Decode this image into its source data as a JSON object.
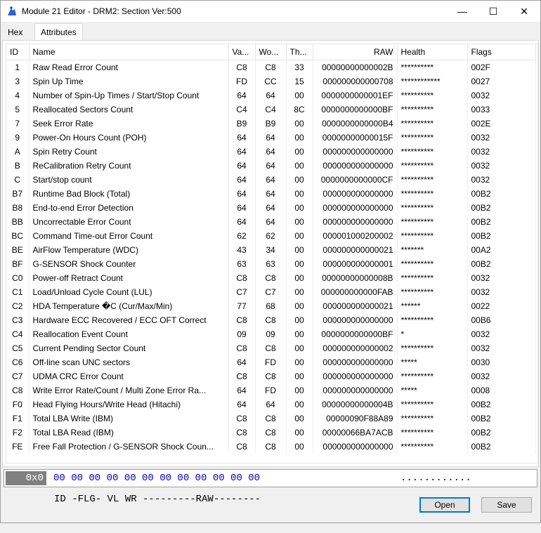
{
  "window": {
    "title": "Module 21 Editor - DRM2: Section Ver:500",
    "min_glyph": "—",
    "max_glyph": "☐",
    "close_glyph": "✕"
  },
  "tabs": [
    "Hex",
    "Attributes"
  ],
  "active_tab": "Attributes",
  "table": {
    "headers": [
      "ID",
      "Name",
      "Va...",
      "Wo...",
      "Th...",
      "RAW",
      "Health",
      "Flags"
    ],
    "rows": [
      [
        "1",
        "Raw Read Error Count",
        "C8",
        "C8",
        "33",
        "00000000000002B",
        "**********",
        "002F"
      ],
      [
        "3",
        "Spin Up Time",
        "FD",
        "CC",
        "15",
        "000000000000708",
        "************",
        "0027"
      ],
      [
        "4",
        "Number of Spin-Up Times / Start/Stop Count",
        "64",
        "64",
        "00",
        "0000000000001EF",
        "**********",
        "0032"
      ],
      [
        "5",
        "Reallocated Sectors Count",
        "C4",
        "C4",
        "8C",
        "0000000000000BF",
        "**********",
        "0033"
      ],
      [
        "7",
        "Seek Error Rate",
        "B9",
        "B9",
        "00",
        "0000000000000B4",
        "**********",
        "002E"
      ],
      [
        "9",
        "Power-On Hours Count (POH)",
        "64",
        "64",
        "00",
        "00000000000015F",
        "**********",
        "0032"
      ],
      [
        "A",
        "Spin Retry Count",
        "64",
        "64",
        "00",
        "000000000000000",
        "**********",
        "0032"
      ],
      [
        "B",
        "ReCalibration Retry Count",
        "64",
        "64",
        "00",
        "000000000000000",
        "**********",
        "0032"
      ],
      [
        "C",
        "Start/stop count",
        "64",
        "64",
        "00",
        "0000000000000CF",
        "**********",
        "0032"
      ],
      [
        "B7",
        "Runtime Bad Block (Total)",
        "64",
        "64",
        "00",
        "000000000000000",
        "**********",
        "00B2"
      ],
      [
        "B8",
        "End-to-end Error Detection",
        "64",
        "64",
        "00",
        "000000000000000",
        "**********",
        "00B2"
      ],
      [
        "BB",
        "Uncorrectable Error Count",
        "64",
        "64",
        "00",
        "000000000000000",
        "**********",
        "00B2"
      ],
      [
        "BC",
        "Command Time-out Error Count",
        "62",
        "62",
        "00",
        "000001000200002",
        "**********",
        "00B2"
      ],
      [
        "BE",
        "AirFlow Temperature (WDC)",
        "43",
        "34",
        "00",
        "000000000000021",
        "*******",
        "00A2"
      ],
      [
        "BF",
        "G-SENSOR Shock Counter",
        "63",
        "63",
        "00",
        "000000000000001",
        "**********",
        "00B2"
      ],
      [
        "C0",
        "Power-off Retract Count",
        "C8",
        "C8",
        "00",
        "00000000000008B",
        "**********",
        "0032"
      ],
      [
        "C1",
        "Load/Unload Cycle Count (LUL)",
        "C7",
        "C7",
        "00",
        "000000000000FAB",
        "**********",
        "0032"
      ],
      [
        "C2",
        "HDA Temperature �C (Cur/Max/Min)",
        "77",
        "68",
        "00",
        "000000000000021",
        "******",
        "0022"
      ],
      [
        "C3",
        "Hardware ECC Recovered / ECC OFT Correct",
        "C8",
        "C8",
        "00",
        "000000000000000",
        "**********",
        "00B6"
      ],
      [
        "C4",
        "Reallocation Event Count",
        "09",
        "09",
        "00",
        "0000000000000BF",
        "*",
        "0032"
      ],
      [
        "C5",
        "Current Pending Sector Count",
        "C8",
        "C8",
        "00",
        "000000000000002",
        "**********",
        "0032"
      ],
      [
        "C6",
        "Off-line scan UNC sectors",
        "64",
        "FD",
        "00",
        "000000000000000",
        "*****",
        "0030"
      ],
      [
        "C7",
        "UDMA CRC Error Count",
        "C8",
        "C8",
        "00",
        "000000000000000",
        "**********",
        "0032"
      ],
      [
        "C8",
        "Write Error Rate/Count / Multi Zone Error Ra...",
        "64",
        "FD",
        "00",
        "000000000000000",
        "*****",
        "0008"
      ],
      [
        "F0",
        "Head Flying Hours/Write Head (Hitachi)",
        "64",
        "64",
        "00",
        "00000000000004B",
        "**********",
        "00B2"
      ],
      [
        "F1",
        "Total LBA Write (IBM)",
        "C8",
        "C8",
        "00",
        "00000090F88A89",
        "**********",
        "00B2"
      ],
      [
        "F2",
        "Total LBA Read (IBM)",
        "C8",
        "C8",
        "00",
        "00000066BA7ACB",
        "**********",
        "00B2"
      ],
      [
        "FE",
        "Free Fall Protection / G-SENSOR Shock Coun...",
        "C8",
        "C8",
        "00",
        "000000000000000",
        "**********",
        "00B2"
      ]
    ]
  },
  "hexbar": {
    "address": "0x0",
    "bytes": "00 00 00 00 00 00 00 00 00 00 00 00",
    "ascii": "............"
  },
  "legend": "ID -FLG- VL WR ---------RAW--------",
  "buttons": {
    "open": "Open",
    "save": "Save"
  }
}
